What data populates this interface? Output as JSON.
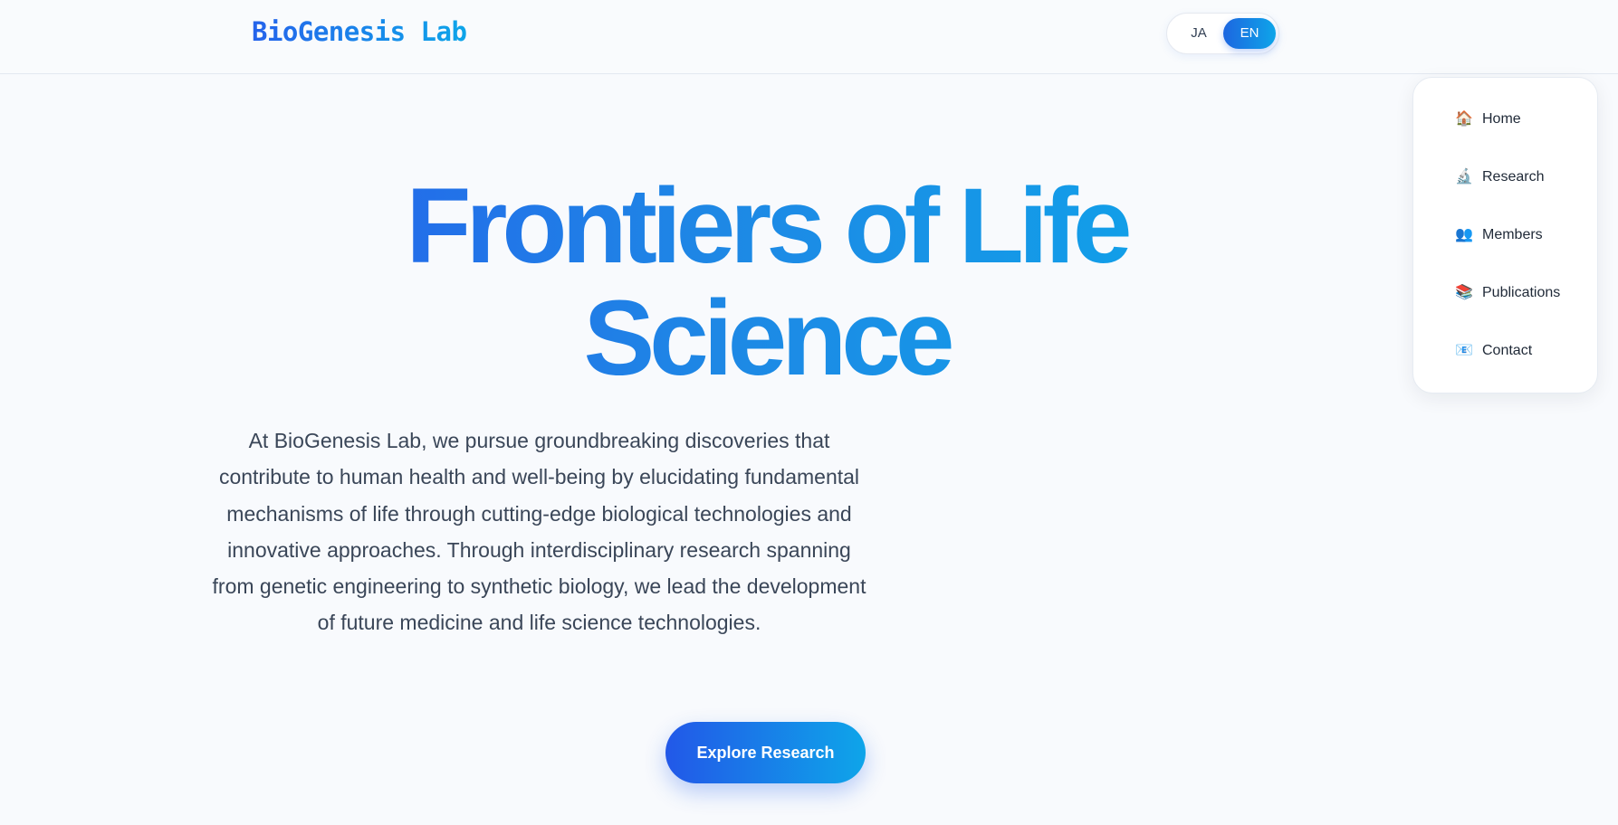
{
  "header": {
    "logo": "BioGenesis Lab",
    "lang": {
      "ja_label": "JA",
      "en_label": "EN",
      "active": "EN"
    }
  },
  "nav": {
    "items": [
      {
        "icon": "🏠",
        "icon_name": "house-icon",
        "label": "Home"
      },
      {
        "icon": "🔬",
        "icon_name": "microscope-icon",
        "label": "Research"
      },
      {
        "icon": "👥",
        "icon_name": "people-icon",
        "label": "Members"
      },
      {
        "icon": "📚",
        "icon_name": "books-icon",
        "label": "Publications"
      },
      {
        "icon": "📧",
        "icon_name": "email-icon",
        "label": "Contact"
      }
    ]
  },
  "hero": {
    "title_line1": "Frontiers of Life",
    "title_line2": "Science",
    "description": "At BioGenesis Lab, we pursue groundbreaking discoveries that contribute to human health and well-being by elucidating fundamental mechanisms of life through cutting-edge biological technologies and innovative approaches. Through interdisciplinary research spanning from genetic engineering to synthetic biology, we lead the development of future medicine and life science technologies.",
    "cta_label": "Explore Research"
  },
  "colors": {
    "accent_start": "#2563eb",
    "accent_end": "#0ea5e9",
    "background": "#f8fafd",
    "text": "#334155"
  }
}
